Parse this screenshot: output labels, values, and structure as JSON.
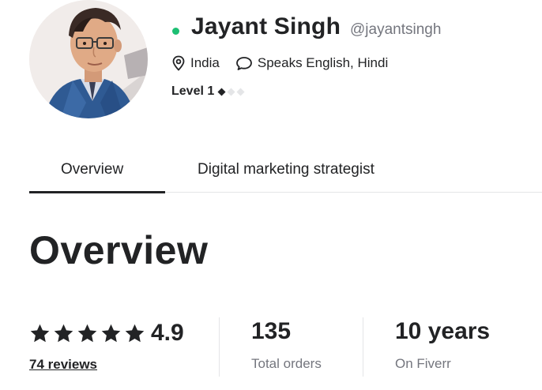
{
  "profile": {
    "name": "Jayant Singh",
    "username": "@jayantsingh",
    "online": true,
    "location": "India",
    "languages": "Speaks English, Hindi",
    "level_label": "Level 1",
    "level_stars_filled": 1,
    "level_stars_total": 3
  },
  "tabs": [
    {
      "label": "Overview",
      "active": true
    },
    {
      "label": "Digital marketing strategist",
      "active": false
    }
  ],
  "overview": {
    "heading": "Overview"
  },
  "stats": {
    "rating": "4.9",
    "stars": 5,
    "reviews_link": "74 reviews",
    "orders_value": "135",
    "orders_label": "Total orders",
    "years_value": "10 years",
    "years_label": "On Fiverr"
  },
  "colors": {
    "online": "#1dbf73",
    "text": "#222325",
    "muted": "#74767e",
    "divider": "#e4e5e7"
  },
  "icons": {
    "location": "location-pin-icon",
    "languages": "speech-bubble-icon",
    "level": "diamond-icon",
    "rating": "star-icon"
  }
}
